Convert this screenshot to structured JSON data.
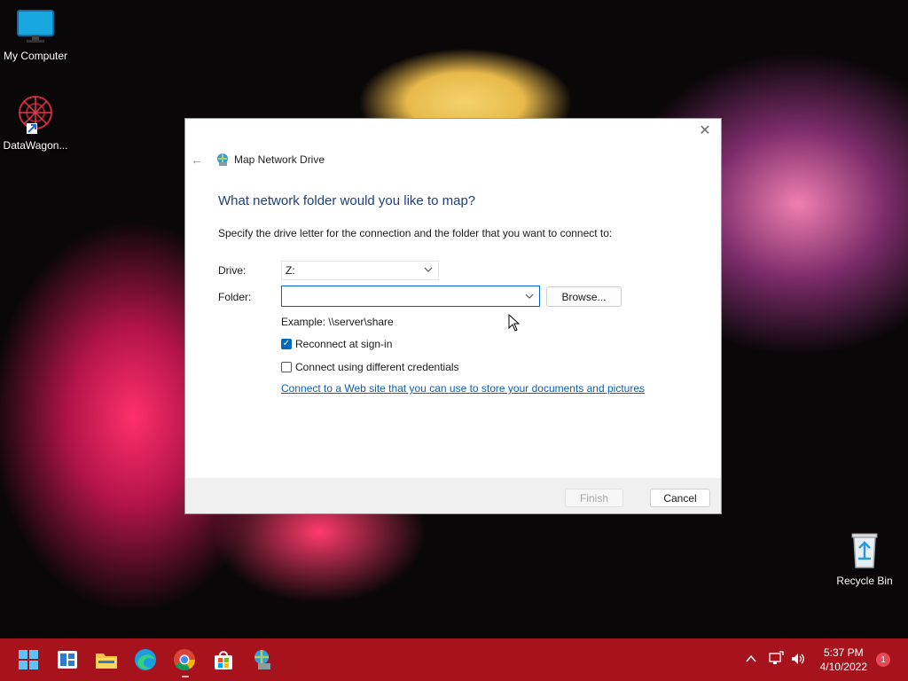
{
  "desktop": {
    "icons": [
      {
        "label": "My Computer",
        "icon": "monitor-icon"
      },
      {
        "label": "DataWagon...",
        "icon": "app-shortcut-icon"
      },
      {
        "label": "Recycle Bin",
        "icon": "recycle-bin-icon"
      }
    ]
  },
  "dialog": {
    "title": "Map Network Drive",
    "heading": "What network folder would you like to map?",
    "instruction": "Specify the drive letter for the connection and the folder that you want to connect to:",
    "drive_label": "Drive:",
    "drive_value": "Z:",
    "folder_label": "Folder:",
    "folder_value": "",
    "browse_label": "Browse...",
    "example": "Example: \\\\server\\share",
    "reconnect_label": "Reconnect at sign-in",
    "reconnect_checked": true,
    "credentials_label": "Connect using different credentials",
    "credentials_checked": false,
    "web_link": "Connect to a Web site that you can use to store your documents and pictures",
    "web_link_end": ".",
    "finish_label": "Finish",
    "cancel_label": "Cancel",
    "close_glyph": "✕",
    "back_glyph": "←"
  },
  "taskbar": {
    "items": [
      "start-icon",
      "widgets-icon",
      "file-explorer-icon",
      "edge-icon",
      "chrome-icon",
      "store-icon",
      "network-drive-icon"
    ],
    "time": "5:37 PM",
    "date": "4/10/2022",
    "notification_count": "1",
    "color": "#a6131d"
  },
  "colors": {
    "accent": "#0067c0",
    "heading": "#1e3f78",
    "link": "#0f5fb3"
  }
}
